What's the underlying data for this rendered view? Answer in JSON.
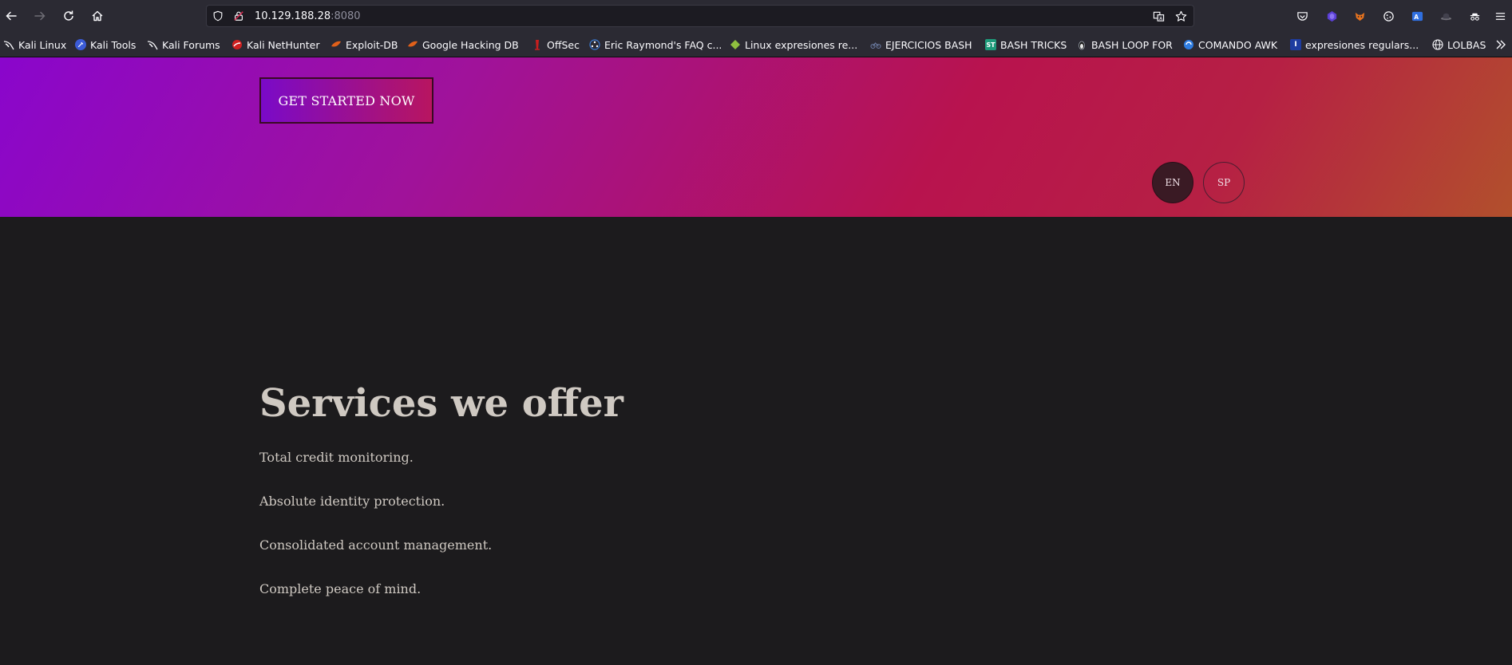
{
  "browser": {
    "url_host": "10.129.188.28",
    "url_port": ":8080",
    "bookmarks": [
      {
        "label": "Kali Linux",
        "icon": "kali-dragon-icon",
        "color": "#1f78d1"
      },
      {
        "label": "Kali Tools",
        "icon": "kali-tools-icon",
        "color": "#3b5bd6"
      },
      {
        "label": "Kali Forums",
        "icon": "kali-dragon-icon",
        "color": "#1f78d1"
      },
      {
        "label": "Kali NetHunter",
        "icon": "nethunter-icon",
        "color": "#d02020"
      },
      {
        "label": "Exploit-DB",
        "icon": "exploitdb-icon",
        "color": "#e0601a"
      },
      {
        "label": "Google Hacking DB",
        "icon": "ghdb-icon",
        "color": "#e0601a"
      },
      {
        "label": "OffSec",
        "icon": "offsec-icon",
        "color": "#c81e1e"
      },
      {
        "label": "Eric Raymond's FAQ c...",
        "icon": "hacker-emblem-icon",
        "color": "#3a7bd5"
      },
      {
        "label": "Linux expresiones re...",
        "icon": "diamond-icon",
        "color": "#8fbf3f"
      },
      {
        "label": "EJERCICIOS BASH",
        "icon": "bike-icon",
        "color": "#6a7aa0"
      },
      {
        "label": "BASH TRICKS",
        "icon": "sti-icon",
        "color": "#1e9a7a"
      },
      {
        "label": "BASH LOOP FOR",
        "icon": "penguin-icon",
        "color": "#9aa0aa"
      },
      {
        "label": "COMANDO AWK",
        "icon": "circle-logo-icon",
        "color": "#2f7de1"
      },
      {
        "label": "expresiones regulars...",
        "icon": "i-logo-icon",
        "color": "#1e3ca0"
      },
      {
        "label": "LOLBAS",
        "icon": "globe-icon",
        "color": "#fbfbfe"
      }
    ]
  },
  "hero": {
    "cta_label": "GET STARTED NOW",
    "lang_en": "EN",
    "lang_sp": "SP"
  },
  "services": {
    "title": "Services we offer",
    "items": [
      "Total credit monitoring.",
      "Absolute identity protection.",
      "Consolidated account management.",
      "Complete peace of mind."
    ]
  }
}
